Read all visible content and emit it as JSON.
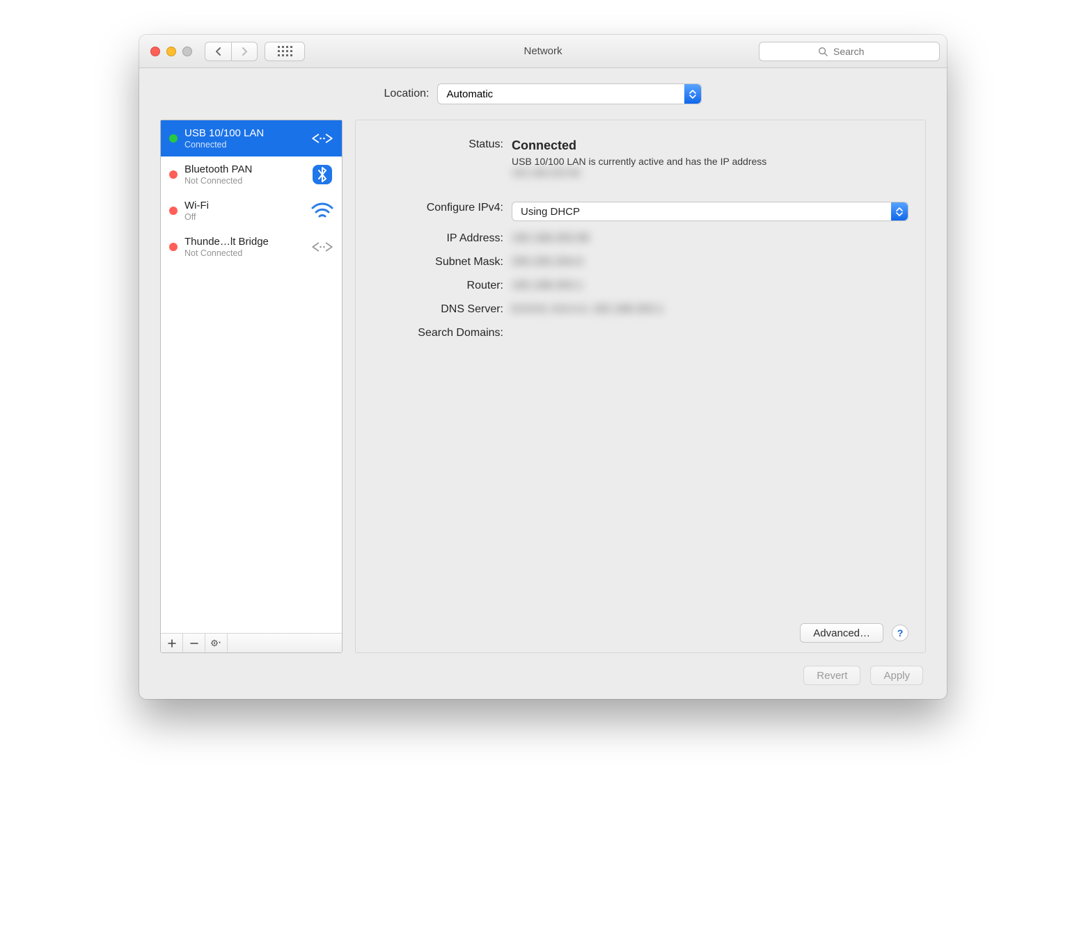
{
  "window": {
    "title": "Network"
  },
  "search": {
    "placeholder": "Search"
  },
  "location": {
    "label": "Location:",
    "selected": "Automatic"
  },
  "sidebar": {
    "items": [
      {
        "name": "USB 10/100 LAN",
        "status": "Connected",
        "dot": "green",
        "icon": "ethernet-icon",
        "selected": true
      },
      {
        "name": "Bluetooth PAN",
        "status": "Not Connected",
        "dot": "red",
        "icon": "bluetooth-icon",
        "selected": false
      },
      {
        "name": "Wi-Fi",
        "status": "Off",
        "dot": "red",
        "icon": "wifi-icon",
        "selected": false
      },
      {
        "name": "Thunde…lt Bridge",
        "status": "Not Connected",
        "dot": "red",
        "icon": "ethernet-icon",
        "selected": false
      }
    ]
  },
  "details": {
    "status_label": "Status:",
    "status_value": "Connected",
    "status_desc_prefix": "USB 10/100 LAN is currently active and has the IP address",
    "status_desc_ip": "192.168.203.58.",
    "configure_label": "Configure IPv4:",
    "configure_value": "Using DHCP",
    "ip_label": "IP Address:",
    "ip_value": "192.168.203.58",
    "subnet_label": "Subnet Mask:",
    "subnet_value": "255.255.254.0",
    "router_label": "Router:",
    "router_value": "192.168.203.1",
    "dns_label": "DNS Server:",
    "dns_value": "8.8.8.8, 8.8.4.4, 192.168.203.1",
    "search_label": "Search Domains:",
    "search_value": " ",
    "advanced": "Advanced…"
  },
  "buttons": {
    "revert": "Revert",
    "apply": "Apply"
  }
}
